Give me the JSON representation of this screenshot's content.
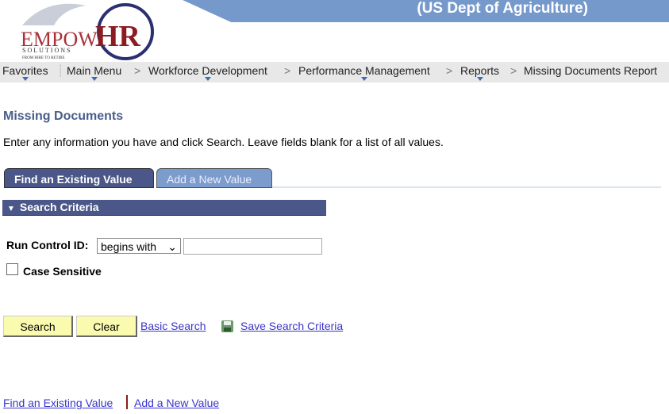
{
  "header": {
    "org": "(US Dept of Agriculture)",
    "logo_text": "EMPOWHR SOLUTIONS FROM HIRE TO RETIRE"
  },
  "nav": {
    "items": [
      {
        "label": "Favorites"
      },
      {
        "label": "Main Menu"
      },
      {
        "label": "Workforce Development"
      },
      {
        "label": "Performance Management"
      },
      {
        "label": "Reports"
      },
      {
        "label": "Missing Documents Report"
      }
    ],
    "separator": ">"
  },
  "page": {
    "title": "Missing Documents",
    "instructions": "Enter any information you have and click Search. Leave fields blank for a list of all values."
  },
  "tabs": [
    {
      "label": "Find an Existing Value",
      "active": true
    },
    {
      "label": "Add a New Value",
      "active": false
    }
  ],
  "criteria": {
    "header": "Search Criteria",
    "run_control_label": "Run Control ID:",
    "operator": "begins with",
    "value": "",
    "case_label": "Case Sensitive",
    "case_checked": false
  },
  "actions": {
    "search": "Search",
    "clear": "Clear",
    "basic": "Basic Search",
    "save": "Save Search Criteria"
  },
  "footer": {
    "find": "Find an Existing Value",
    "add": "Add a New Value"
  }
}
